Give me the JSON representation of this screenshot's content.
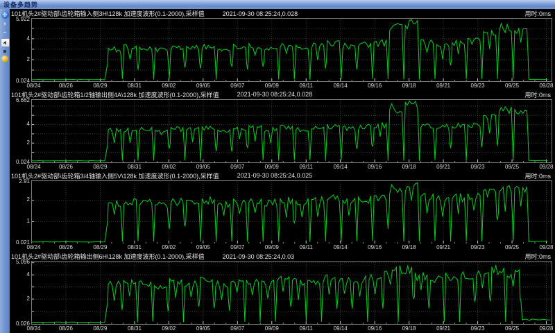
{
  "window": {
    "title": "设备多趋势"
  },
  "toolbar": {
    "tools": [
      {
        "name": "navigate-tool",
        "glyph": "✣"
      },
      {
        "name": "zoom-in-tool",
        "glyph": "⁺₊"
      },
      {
        "name": "zoom-out-tool",
        "glyph": "⁻₌"
      },
      {
        "name": "cursor-tool",
        "glyph": "➤",
        "selected": true
      },
      {
        "name": "marker-tool",
        "glyph": ""
      },
      {
        "name": "sphere-tool",
        "glyph": ""
      }
    ]
  },
  "chart_data": [
    {
      "type": "line",
      "header": "101机头2#驱动部\\齿轮箱输入侧3H\\128k 加速度波形(0.1-2000),采样值",
      "time": "2021-09-30 08:25:24,0.028",
      "elapsed": "用时:0ms",
      "y_top": 5.922,
      "y_top_label": "5.922",
      "y_min_label": "0.024",
      "y_ticks": [
        {
          "v": 2,
          "label": "2"
        },
        {
          "v": 4,
          "label": "4"
        }
      ],
      "x_labels": [
        "08/24",
        "08/26",
        "08/29",
        "08/31",
        "09/02",
        "09/05",
        "09/07",
        "09/09",
        "09/11",
        "09/14",
        "09/16",
        "09/18",
        "09/21",
        "09/23",
        "09/25",
        "09/28"
      ],
      "line_color": "#00d020",
      "grid_color": "#3c3c3c",
      "burst_region": [
        0.145,
        0.955
      ],
      "base_value": 0.08,
      "tail_value": 0.1,
      "levels": [
        3.1,
        3.3,
        3.2,
        3.0,
        3.3,
        3.2,
        3.4,
        3.1,
        3.3,
        3.4,
        3.2,
        3.5,
        3.3,
        3.4,
        3.6,
        3.4,
        3.5,
        3.7,
        5.4,
        5.6,
        3.8,
        3.6,
        3.7,
        3.9,
        4.6,
        5.2,
        5.0
      ]
    },
    {
      "type": "line",
      "header": "101机头2#驱动部\\齿轮箱1/2轴输出侧4A\\128k 加速度波形(0.1-2000),采样值",
      "time": "2021-09-30 08:25:24,0.028",
      "elapsed": "用时:0ms",
      "y_top": 6.662,
      "y_top_label": "6.662",
      "y_min_label": "0.024",
      "y_ticks": [
        {
          "v": 2,
          "label": "2"
        },
        {
          "v": 4,
          "label": "4"
        }
      ],
      "x_labels": [
        "08/24",
        "08/26",
        "08/29",
        "08/31",
        "09/02",
        "09/05",
        "09/07",
        "09/09",
        "09/11",
        "09/14",
        "09/16",
        "09/18",
        "09/21",
        "09/23",
        "09/25",
        "09/28"
      ],
      "line_color": "#00d020",
      "grid_color": "#3c3c3c",
      "burst_region": [
        0.145,
        0.955
      ],
      "base_value": 0.09,
      "tail_value": 0.11,
      "levels": [
        3.4,
        3.6,
        3.5,
        3.3,
        3.6,
        3.5,
        3.7,
        3.4,
        3.6,
        3.7,
        3.5,
        3.8,
        3.6,
        3.7,
        3.9,
        3.7,
        3.8,
        4.0,
        5.9,
        6.2,
        4.1,
        3.9,
        4.0,
        4.2,
        5.2,
        5.7,
        5.5
      ]
    },
    {
      "type": "line",
      "header": "101机头2#驱动部\\齿轮箱3/4轴输入侧5V\\128k 加速度波形(0.1-2000),采样值",
      "time": "2021-09-30 08:25:24,0.025",
      "elapsed": "用时:0ms",
      "y_top": 2.91,
      "y_top_label": "2.91",
      "y_min_label": "0.021",
      "y_ticks": [
        {
          "v": 1,
          "label": "1"
        },
        {
          "v": 2,
          "label": "2"
        }
      ],
      "x_labels": [
        "08/24",
        "08/26",
        "08/29",
        "08/31",
        "09/02",
        "09/05",
        "09/07",
        "09/09",
        "09/11",
        "09/14",
        "09/16",
        "09/18",
        "09/21",
        "09/23",
        "09/25",
        "09/28"
      ],
      "line_color": "#00d020",
      "grid_color": "#3c3c3c",
      "burst_region": [
        0.145,
        0.955
      ],
      "base_value": 0.045,
      "tail_value": 0.06,
      "levels": [
        1.9,
        2.0,
        1.95,
        1.85,
        2.0,
        1.95,
        2.05,
        1.9,
        2.0,
        2.05,
        1.95,
        2.1,
        2.0,
        2.05,
        2.15,
        2.05,
        2.1,
        2.2,
        2.6,
        2.7,
        2.25,
        2.15,
        2.2,
        2.3,
        2.45,
        2.6,
        2.55
      ]
    },
    {
      "type": "line",
      "header": "101机头2#驱动部\\齿轮箱输出侧6H\\128k 加速度波形(0.1-2000),采样值",
      "time": "2021-09-30 08:25:24,0.03",
      "elapsed": "用时:0ms",
      "y_top": 5.096,
      "y_top_label": "5.096",
      "y_min_label": "0.026",
      "y_ticks": [
        {
          "v": 2,
          "label": "2"
        },
        {
          "v": 4,
          "label": "4"
        }
      ],
      "x_labels": [
        "08/24",
        "08/26",
        "08/29",
        "08/31",
        "09/02",
        "09/05",
        "09/07",
        "09/09",
        "09/11",
        "09/14",
        "09/16",
        "09/18",
        "09/21",
        "09/23",
        "09/25",
        "09/28"
      ],
      "line_color": "#00d020",
      "grid_color": "#3c3c3c",
      "burst_region": [
        0.145,
        0.94
      ],
      "base_value": 0.08,
      "tail_value": 0.3,
      "levels": [
        3.3,
        3.5,
        3.4,
        3.2,
        3.5,
        3.4,
        3.6,
        3.3,
        3.5,
        3.6,
        3.4,
        3.7,
        3.5,
        3.6,
        3.8,
        3.6,
        3.7,
        3.9,
        4.4,
        4.6,
        4.0,
        3.8,
        3.9,
        4.1,
        4.3,
        4.5,
        4.2
      ]
    }
  ]
}
